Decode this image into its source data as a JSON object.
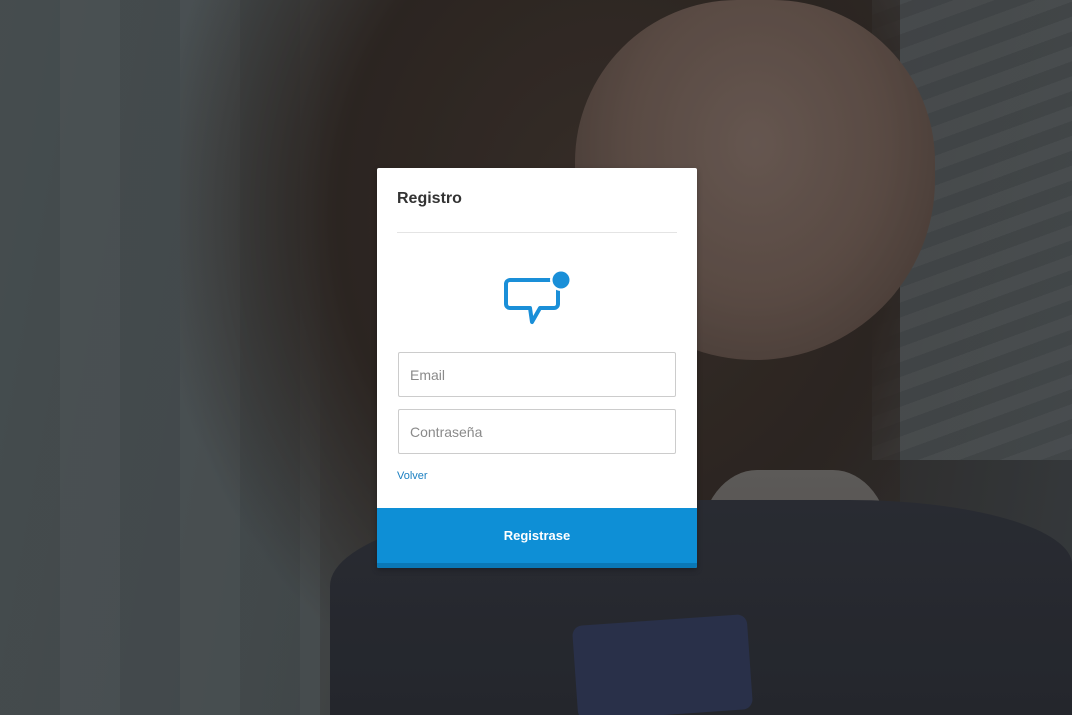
{
  "card": {
    "title": "Registro"
  },
  "logo": {
    "icon": "chat-bubble-notification-icon",
    "color": "#1a8fd8"
  },
  "form": {
    "email_placeholder": "Email",
    "email_value": "",
    "password_placeholder": "Contraseña",
    "password_value": "",
    "back_link_label": "Volver",
    "submit_label": "Registrase"
  },
  "colors": {
    "accent": "#0e8fd6",
    "link": "#1a7fc1"
  }
}
